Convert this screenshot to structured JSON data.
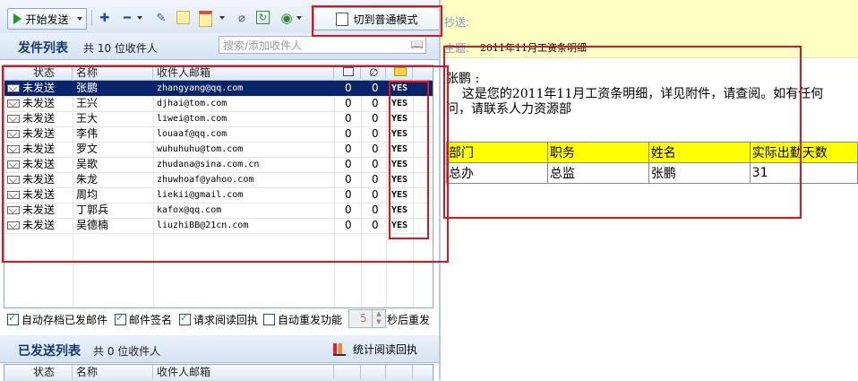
{
  "toolbar": {
    "send_label": "开始发送",
    "mode_label": "切到普通模式",
    "icons": [
      "add-icon",
      "remove-icon",
      "edit-icon",
      "note-icon",
      "template-icon",
      "attach-icon",
      "refresh-icon",
      "globe-icon"
    ]
  },
  "sent_pending": {
    "title": "发件列表",
    "count": "共 10 位收件人",
    "search_placeholder": "搜索/添加收件人",
    "columns": [
      "状态",
      "名称",
      "收件人邮箱",
      "",
      "",
      ""
    ],
    "rows": [
      {
        "status": "未发送",
        "name": "张鹏",
        "email": "zhangyang@qq.com",
        "a": "0",
        "b": "0",
        "c": "YES"
      },
      {
        "status": "未发送",
        "name": "王兴",
        "email": "djhai@tom.com",
        "a": "0",
        "b": "0",
        "c": "YES"
      },
      {
        "status": "未发送",
        "name": "王大",
        "email": "liwei@tom.com",
        "a": "0",
        "b": "0",
        "c": "YES"
      },
      {
        "status": "未发送",
        "name": "李伟",
        "email": "louaaf@qq.com",
        "a": "0",
        "b": "0",
        "c": "YES"
      },
      {
        "status": "未发送",
        "name": "罗文",
        "email": "wuhuhuhu@tom.com",
        "a": "0",
        "b": "0",
        "c": "YES"
      },
      {
        "status": "未发送",
        "name": "吴歌",
        "email": "zhudana@sina.com.cn",
        "a": "0",
        "b": "0",
        "c": "YES"
      },
      {
        "status": "未发送",
        "name": "朱龙",
        "email": "zhuwhoaf@yahoo.com",
        "a": "0",
        "b": "0",
        "c": "YES"
      },
      {
        "status": "未发送",
        "name": "周均",
        "email": "liekii@gmail.com",
        "a": "0",
        "b": "0",
        "c": "YES"
      },
      {
        "status": "未发送",
        "name": "丁郭兵",
        "email": "kafox@qq.com",
        "a": "0",
        "b": "0",
        "c": "YES"
      },
      {
        "status": "未发送",
        "name": "吴德楠",
        "email": "liuzhiBB@21cn.com",
        "a": "0",
        "b": "0",
        "c": "YES"
      }
    ]
  },
  "options": {
    "auto_archive": "自动存档已发邮件",
    "signature": "邮件签名",
    "read_receipt": "请求阅读回执",
    "auto_resend": "自动重发功能",
    "resend_value": "5",
    "resend_suffix": "秒后重发"
  },
  "sent_done": {
    "title": "已发送列表",
    "count": "共 0 位收件人",
    "stats_label": "统计阅读回执",
    "columns": [
      "状态",
      "名称",
      "收件人邮箱"
    ]
  },
  "message": {
    "cc_label": "抄送:",
    "subject_label": "主题:",
    "subject": "2011年11月工资条明细",
    "greeting": "张鹏 :",
    "line1": "    这是您的2011年11月工资条明细，详见附件，请查阅。如有任何",
    "line2": "问，请联系人力资源部",
    "table_header": [
      "部门",
      "职务",
      "姓名",
      "实际出勤天数"
    ],
    "table_row": [
      "总办",
      "总监",
      "张鹏",
      "31"
    ]
  }
}
